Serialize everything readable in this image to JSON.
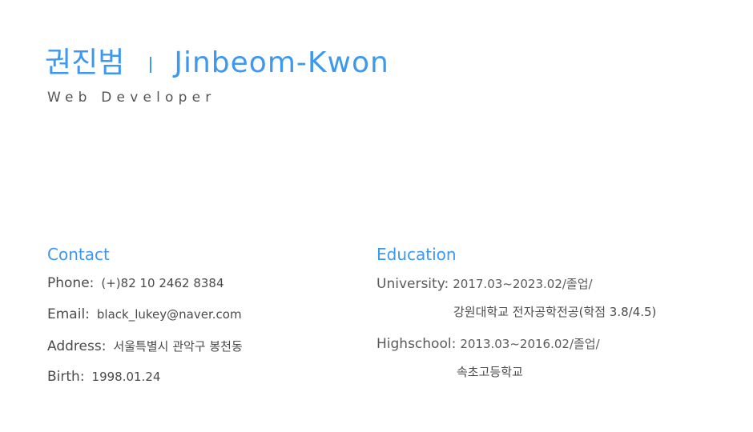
{
  "header": {
    "name_ko": "권진범",
    "name_en": "Jinbeom-Kwon",
    "role": "Web Developer"
  },
  "contact": {
    "title": "Contact",
    "items": [
      {
        "label": "Phone:",
        "value": "(+)82 10 2462 8384"
      },
      {
        "label": "Email:",
        "value": "black_lukey@naver.com"
      },
      {
        "label": "Address:",
        "value": "서울특별시 관악구 봉천동"
      },
      {
        "label": "Birth:",
        "value": "1998.01.24"
      }
    ]
  },
  "education": {
    "title": "Education",
    "items": [
      {
        "label": "University:",
        "value": "2017.03~2023.02/졸업/",
        "detail": "강원대학교 전자공학전공(학점 3.8/4.5)"
      },
      {
        "label": "Highschool:",
        "value": "2013.03~2016.02/졸업/",
        "detail": "속초고등학교"
      }
    ]
  },
  "colors": {
    "accent": "#3d98f0",
    "text": "#4a4a4a",
    "background": "#ffffff"
  }
}
